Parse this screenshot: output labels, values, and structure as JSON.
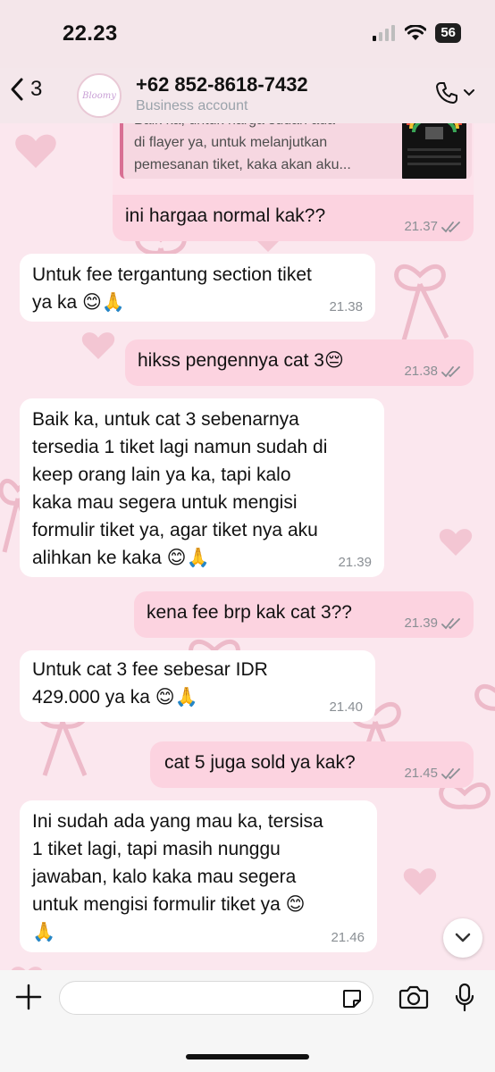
{
  "status_bar": {
    "time": "22.23",
    "battery": "56"
  },
  "header": {
    "back_count": "3",
    "contact_name": "+62 852-8618-7432",
    "contact_subtitle": "Business account",
    "avatar_text": "Bloomy"
  },
  "reply_preview": {
    "text": "Baik ka, untuk harga sudah ada\ndi flayer ya, untuk melanjutkan\npemesanan tiket, kaka akan aku..."
  },
  "messages": [
    {
      "direction": "out",
      "text": "ini hargaa normal kak??",
      "time": "21.37",
      "read": true
    },
    {
      "direction": "in",
      "text": "Untuk fee tergantung section tiket\nya ka 😊🙏",
      "time": "21.38"
    },
    {
      "direction": "out",
      "text": "hikss pengennya cat 3😔",
      "time": "21.38",
      "read": true
    },
    {
      "direction": "in",
      "text": "Baik ka, untuk cat 3 sebenarnya\ntersedia 1 tiket lagi namun sudah di\nkeep orang lain ya ka, tapi kalo\nkaka mau segera untuk mengisi\nformulir tiket ya, agar tiket nya aku\nalihkan ke kaka 😊🙏",
      "time": "21.39"
    },
    {
      "direction": "out",
      "text": "kena fee brp kak cat 3??",
      "time": "21.39",
      "read": true
    },
    {
      "direction": "in",
      "text": "Untuk cat 3 fee sebesar IDR\n429.000 ya ka 😊🙏",
      "time": "21.40"
    },
    {
      "direction": "out",
      "text": "cat 5 juga sold ya kak?",
      "time": "21.45",
      "read": true
    },
    {
      "direction": "in",
      "text": "Ini sudah ada yang mau ka, tersisa\n1 tiket lagi, tapi masih nunggu\njawaban, kalo kaka mau segera\nuntuk mengisi formulir tiket ya 😊\n🙏",
      "time": "21.46"
    }
  ],
  "composer": {
    "placeholder": ""
  },
  "colors": {
    "incoming": "#ffffff",
    "outgoing": "#fcd3e0",
    "tick": "#8a8f94",
    "wallpaper": "#fbe7ee"
  }
}
